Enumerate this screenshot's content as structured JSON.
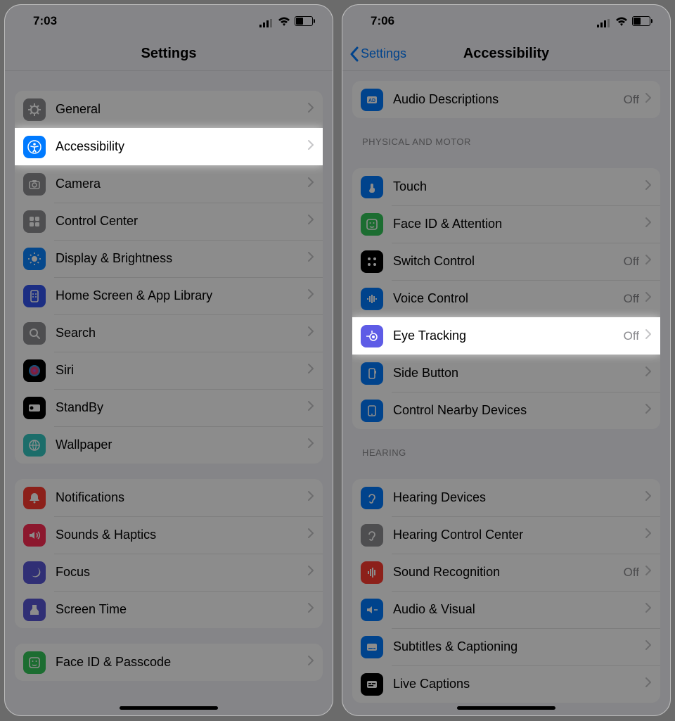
{
  "left": {
    "time": "7:03",
    "title": "Settings",
    "groups": [
      {
        "items": [
          {
            "label": "General",
            "icon": "gear-icon",
            "bg": "#8e8e93"
          },
          {
            "label": "Accessibility",
            "icon": "accessibility-icon",
            "bg": "#007aff",
            "highlight": true
          },
          {
            "label": "Camera",
            "icon": "camera-icon",
            "bg": "#8e8e93"
          },
          {
            "label": "Control Center",
            "icon": "control-center-icon",
            "bg": "#8e8e93"
          },
          {
            "label": "Display & Brightness",
            "icon": "brightness-icon",
            "bg": "#0a84ff"
          },
          {
            "label": "Home Screen & App Library",
            "icon": "home-screen-icon",
            "bg": "#3355ee"
          },
          {
            "label": "Search",
            "icon": "search-icon",
            "bg": "#8e8e93"
          },
          {
            "label": "Siri",
            "icon": "siri-icon",
            "bg": "#000000"
          },
          {
            "label": "StandBy",
            "icon": "standby-icon",
            "bg": "#000000"
          },
          {
            "label": "Wallpaper",
            "icon": "wallpaper-icon",
            "bg": "#34c7c2"
          }
        ]
      },
      {
        "items": [
          {
            "label": "Notifications",
            "icon": "notifications-icon",
            "bg": "#ff3b30"
          },
          {
            "label": "Sounds & Haptics",
            "icon": "sounds-icon",
            "bg": "#ff2d55"
          },
          {
            "label": "Focus",
            "icon": "focus-icon",
            "bg": "#5856d6"
          },
          {
            "label": "Screen Time",
            "icon": "screentime-icon",
            "bg": "#5856d6"
          }
        ]
      },
      {
        "items": [
          {
            "label": "Face ID & Passcode",
            "icon": "faceid-icon",
            "bg": "#34c759"
          }
        ]
      }
    ]
  },
  "right": {
    "time": "7:06",
    "back": "Settings",
    "title": "Accessibility",
    "sections": [
      {
        "header": null,
        "items": [
          {
            "label": "Audio Descriptions",
            "icon": "audio-desc-icon",
            "bg": "#007aff",
            "value": "Off"
          }
        ]
      },
      {
        "header": "PHYSICAL AND MOTOR",
        "items": [
          {
            "label": "Touch",
            "icon": "touch-icon",
            "bg": "#007aff"
          },
          {
            "label": "Face ID & Attention",
            "icon": "faceid-attention-icon",
            "bg": "#34c759"
          },
          {
            "label": "Switch Control",
            "icon": "switch-control-icon",
            "bg": "#000000",
            "value": "Off"
          },
          {
            "label": "Voice Control",
            "icon": "voice-control-icon",
            "bg": "#007aff",
            "value": "Off"
          },
          {
            "label": "Eye Tracking",
            "icon": "eye-tracking-icon",
            "bg": "#5e5ce6",
            "value": "Off",
            "highlight": true
          },
          {
            "label": "Side Button",
            "icon": "side-button-icon",
            "bg": "#007aff"
          },
          {
            "label": "Control Nearby Devices",
            "icon": "nearby-devices-icon",
            "bg": "#007aff"
          }
        ]
      },
      {
        "header": "HEARING",
        "items": [
          {
            "label": "Hearing Devices",
            "icon": "hearing-devices-icon",
            "bg": "#007aff"
          },
          {
            "label": "Hearing Control Center",
            "icon": "hearing-cc-icon",
            "bg": "#8e8e93"
          },
          {
            "label": "Sound Recognition",
            "icon": "sound-recognition-icon",
            "bg": "#ff3b30",
            "value": "Off"
          },
          {
            "label": "Audio & Visual",
            "icon": "audio-visual-icon",
            "bg": "#007aff"
          },
          {
            "label": "Subtitles & Captioning",
            "icon": "subtitles-icon",
            "bg": "#007aff"
          },
          {
            "label": "Live Captions",
            "icon": "live-captions-icon",
            "bg": "#000000"
          }
        ]
      }
    ]
  }
}
